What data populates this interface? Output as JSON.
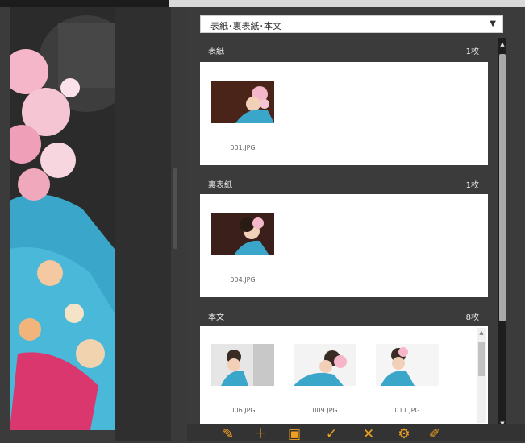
{
  "dropdown": {
    "value": "表紙･裏表紙･本文"
  },
  "sections": [
    {
      "title": "表紙",
      "count": "1枚",
      "items": [
        {
          "filename": "001.JPG"
        }
      ]
    },
    {
      "title": "裏表紙",
      "count": "1枚",
      "items": [
        {
          "filename": "004.JPG"
        }
      ]
    },
    {
      "title": "本文",
      "count": "8枚",
      "items": [
        {
          "filename": "006.JPG"
        },
        {
          "filename": "009.JPG"
        },
        {
          "filename": "011.JPG"
        }
      ]
    }
  ],
  "toolbar": {
    "icons": [
      "edit-icon",
      "add-icon",
      "photo-icon",
      "photo-check-icon",
      "photo-remove-icon",
      "photo-settings-icon",
      "pencil-icon"
    ]
  },
  "colors": {
    "accent": "#f0a020",
    "panel_bg": "#3b3b3b",
    "card_bg": "#ffffff",
    "scrollbar": "#a9a9a9"
  }
}
